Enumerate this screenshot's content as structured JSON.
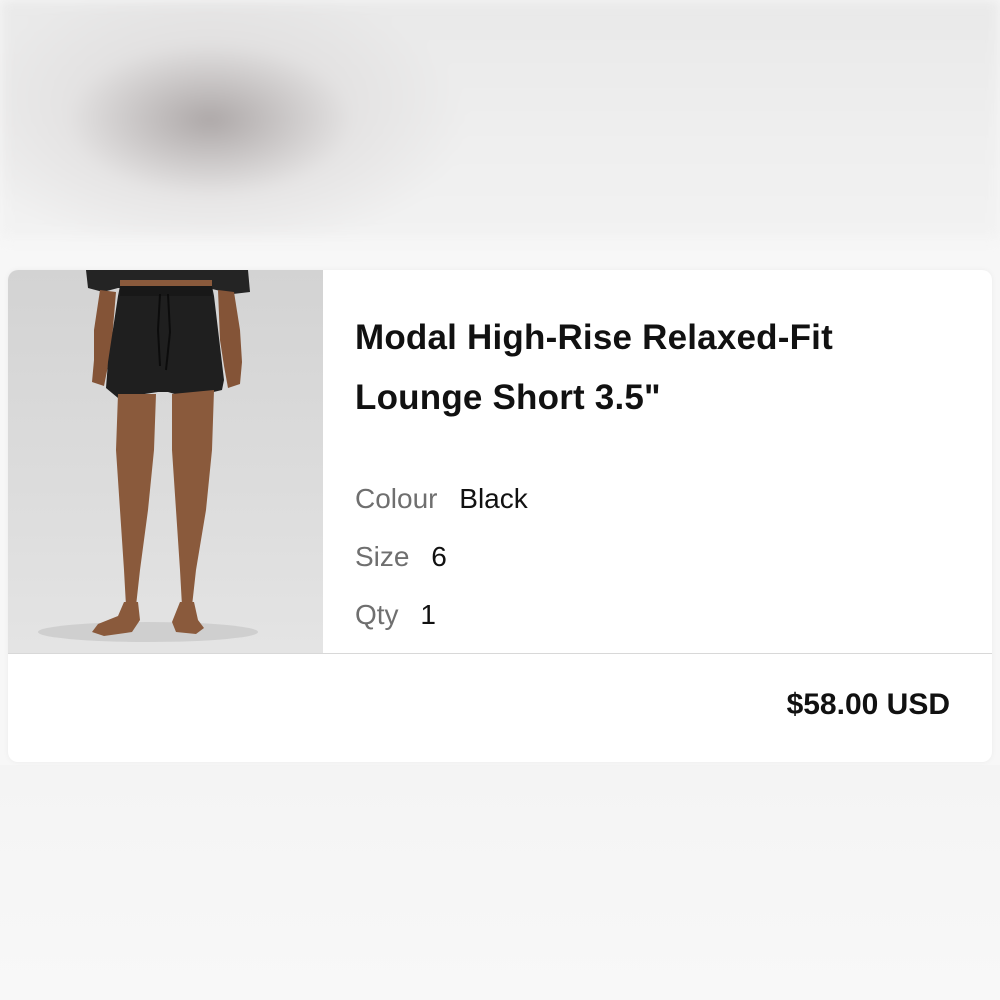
{
  "cart_item": {
    "image": {
      "alt": "product-photo-black-lounge-shorts"
    },
    "title": "Modal High-Rise Relaxed-Fit Lounge Short 3.5\"",
    "attributes": [
      {
        "label": "Colour",
        "value": "Black"
      },
      {
        "label": "Size",
        "value": "6"
      },
      {
        "label": "Qty",
        "value": "1"
      }
    ],
    "price": "$58.00 USD"
  },
  "colors": {
    "card_background": "#ffffff",
    "text_primary": "#111111",
    "text_secondary": "#6f6f6f",
    "divider": "#d8d8d8",
    "short_fabric": "#1f1f1f",
    "skin": "#8a5a3c"
  }
}
